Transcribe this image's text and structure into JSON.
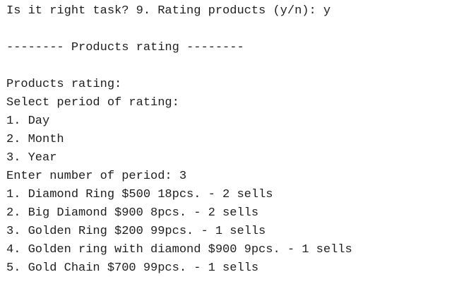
{
  "console": {
    "prompt_line": "Is it right task? 9. Rating products (y/n): y",
    "section_header": "-------- Products rating --------",
    "heading": "Products rating:",
    "select_prompt": "Select period of rating:",
    "periods": [
      "1. Day",
      "2. Month",
      "3. Year"
    ],
    "period_input": "Enter number of period: 3",
    "ratings": [
      "1. Diamond Ring $500 18pcs. - 2 sells",
      "2. Big Diamond $900 8pcs. - 2 sells",
      "3. Golden Ring $200 99pcs. - 1 sells",
      "4. Golden ring with diamond $900 9pcs. - 1 sells",
      "5. Gold Chain $700 99pcs. - 1 sells"
    ]
  }
}
